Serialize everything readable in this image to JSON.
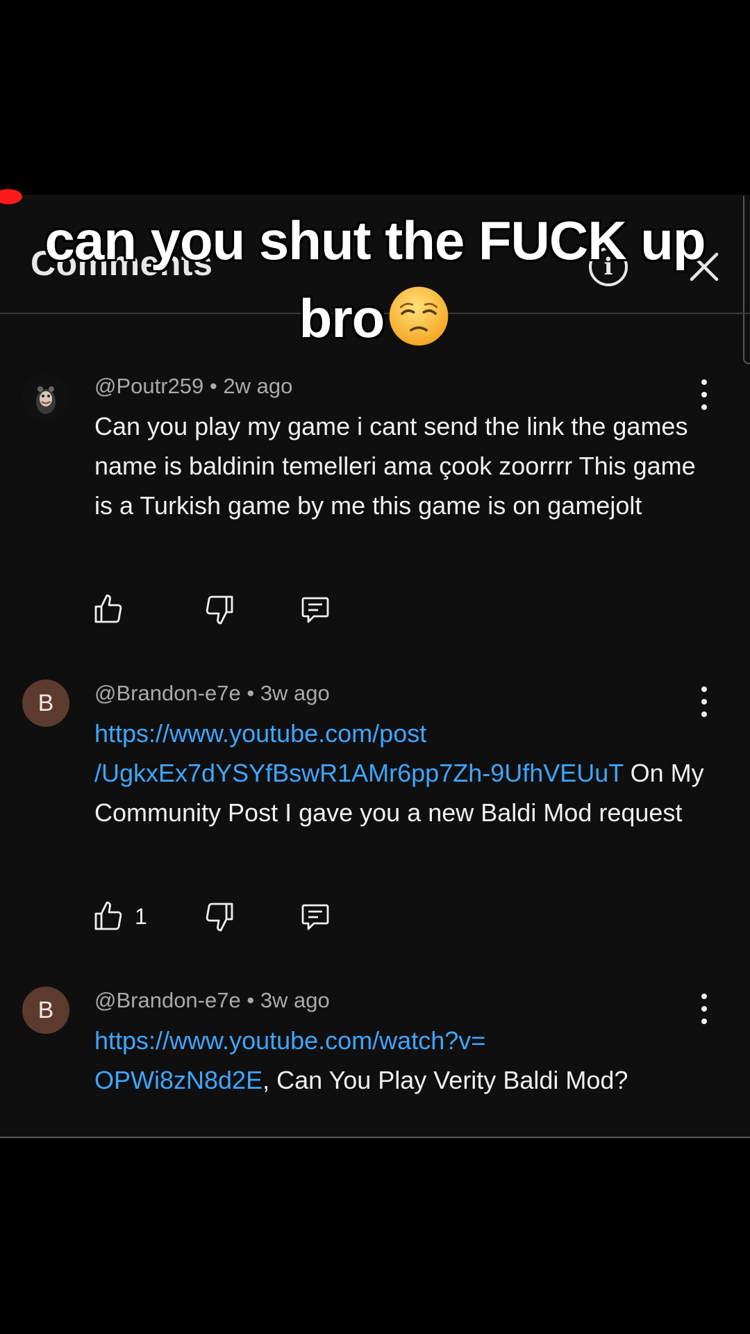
{
  "header": {
    "title": "Comments"
  },
  "caption": {
    "line1": "can you shut the FUCK up",
    "line2": "bro"
  },
  "comments": [
    {
      "handle": "@Poutr259",
      "time": "2w ago",
      "text": "Can you play my game i cant send the link the games name is baldinin temelleri ama çook zoorrrr This game is a Turkish game by me this game is on gamejolt",
      "likes": ""
    },
    {
      "avatar_letter": "B",
      "handle": "@Brandon-e7e",
      "time": "3w ago",
      "link1": "https://www.youtube.com/post",
      "link2": "/UgkxEx7dYSYfBswR1AMr6pp7Zh-9UfhVEUuT",
      "text": " On My Community Post I gave you a new Baldi Mod request",
      "likes": "1"
    },
    {
      "avatar_letter": "B",
      "handle": "@Brandon-e7e",
      "time": "3w ago",
      "link1": "https://www.youtube.com/watch?v=",
      "link2": "OPWi8zN8d2E",
      "text": ", Can You Play Verity Baldi Mod?"
    }
  ],
  "separator": " • ",
  "colors": {
    "link": "#3ea6ff",
    "avatar_b": "#5c3b2e",
    "background": "#0f0f0f"
  },
  "icons": [
    "info-icon",
    "close-icon",
    "more-vert-icon",
    "thumb-up-icon",
    "thumb-down-icon",
    "reply-icon",
    "unamused-face-emoji"
  ]
}
